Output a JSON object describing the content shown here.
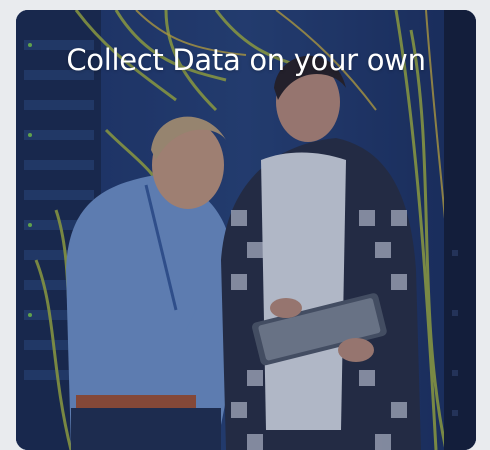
{
  "card": {
    "title": "Collect Data on your own",
    "image_alt": "Two men looking at a tablet in a server room"
  },
  "colors": {
    "card_tint": "#1a2c56",
    "title_text": "#ffffff",
    "page_background": "#e9ebee"
  }
}
